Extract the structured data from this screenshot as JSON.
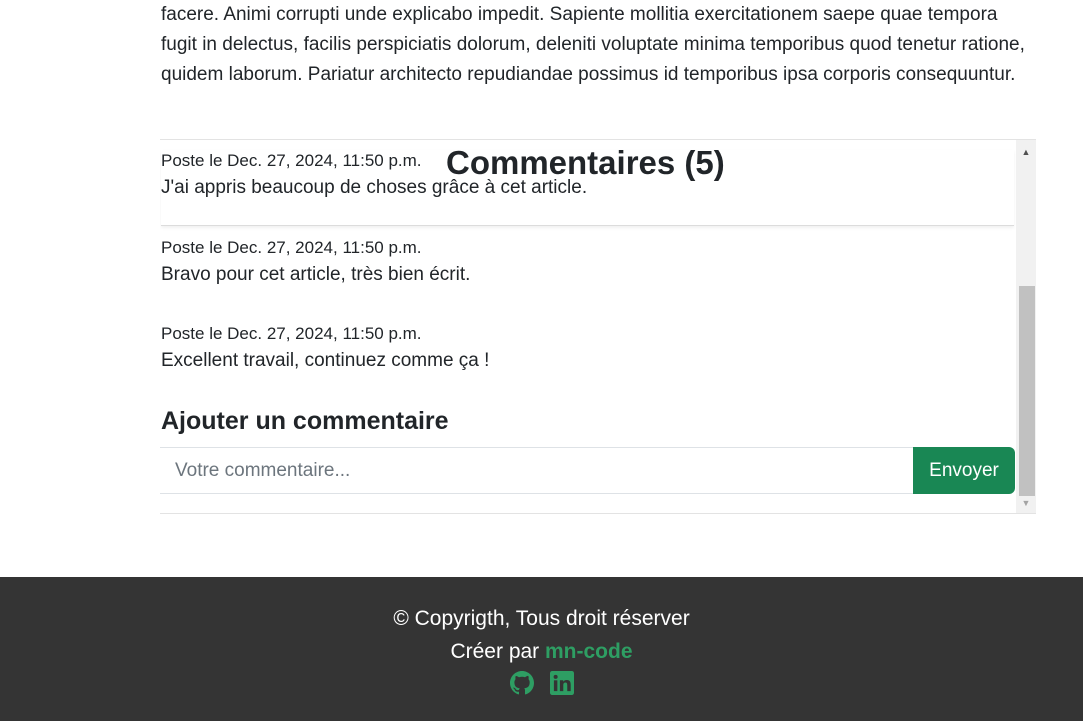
{
  "article": {
    "text": "facere. Animi corrupti unde explicabo impedit. Sapiente mollitia exercitationem saepe quae tempora fugit in delectus, facilis perspiciatis dolorum, deleniti voluptate minima temporibus quod tenetur ratione, quidem laborum. Pariatur architecto repudiandae possimus id temporibus ipsa corporis consequuntur."
  },
  "comments": {
    "title": "Commentaires (5)",
    "items": [
      {
        "date": "Poste le Dec. 27, 2024, 11:50 p.m.",
        "text": "J'ai appris beaucoup de choses grâce à cet article."
      },
      {
        "date": "Poste le Dec. 27, 2024, 11:50 p.m.",
        "text": "Bravo pour cet article, très bien écrit."
      },
      {
        "date": "Poste le Dec. 27, 2024, 11:50 p.m.",
        "text": "Excellent travail, continuez comme ça !"
      }
    ],
    "add_title": "Ajouter un commentaire",
    "input_placeholder": "Votre commentaire...",
    "submit_label": "Envoyer"
  },
  "footer": {
    "copyright": "© Copyrigth, Tous droit réserver",
    "created_prefix": "Créer par ",
    "brand": "mn-code",
    "social_icons": [
      "github-icon",
      "linkedin-icon"
    ],
    "accent_color": "#2e9e63"
  },
  "colors": {
    "button": "#198754",
    "footer_bg": "#343434"
  }
}
